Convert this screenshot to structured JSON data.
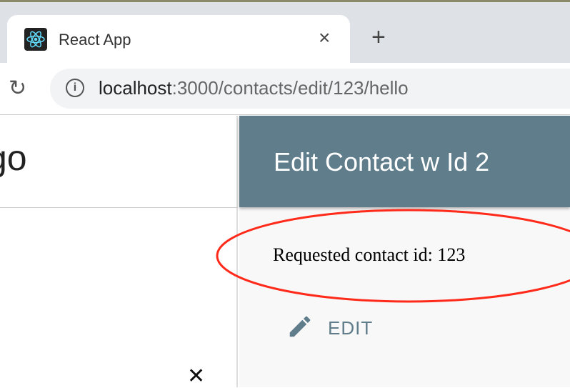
{
  "browser": {
    "tab_title": "React App",
    "url_host": "localhost",
    "url_rest": ":3000/contacts/edit/123/hello",
    "new_tab": "+",
    "close_tab": "×",
    "reload": "↻",
    "info": "i"
  },
  "left_panel": {
    "title_fragment": "go",
    "close": "✕"
  },
  "main": {
    "header_title": "Edit Contact w Id 2",
    "requested_text": "Requested contact id: 123",
    "edit_label": "EDIT"
  },
  "colors": {
    "header": "#607d8b",
    "annotation": "#ff2a1a"
  }
}
